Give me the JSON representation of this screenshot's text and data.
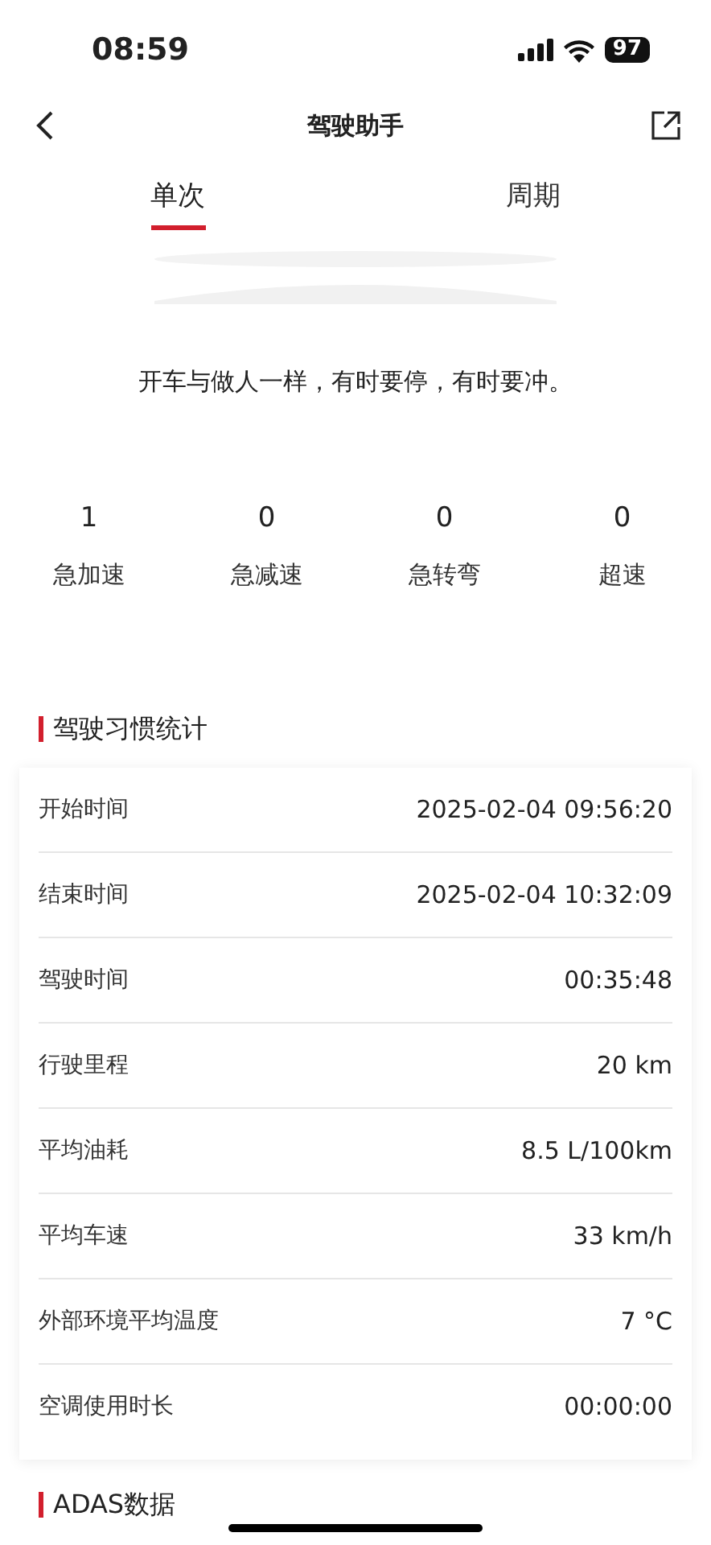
{
  "status_bar": {
    "time": "08:59",
    "battery": "97"
  },
  "nav": {
    "title": "驾驶助手"
  },
  "tabs": [
    {
      "label": "单次",
      "selected": true
    },
    {
      "label": "周期",
      "selected": false
    }
  ],
  "quote": "开车与做人一样，有时要停，有时要冲。",
  "events": [
    {
      "count": "1",
      "label": "急加速"
    },
    {
      "count": "0",
      "label": "急减速"
    },
    {
      "count": "0",
      "label": "急转弯"
    },
    {
      "count": "0",
      "label": "超速"
    }
  ],
  "habits": {
    "title": "驾驶习惯统计",
    "rows": [
      {
        "label": "开始时间",
        "value": "2025-02-04 09:56:20"
      },
      {
        "label": "结束时间",
        "value": "2025-02-04 10:32:09"
      },
      {
        "label": "驾驶时间",
        "value": "00:35:48"
      },
      {
        "label": "行驶里程",
        "value": "20 km"
      },
      {
        "label": "平均油耗",
        "value": "8.5 L/100km"
      },
      {
        "label": "平均车速",
        "value": "33 km/h"
      },
      {
        "label": "外部环境平均温度",
        "value": "7 °C"
      },
      {
        "label": "空调使用时长",
        "value": "00:00:00"
      }
    ]
  },
  "adas": {
    "title": "ADAS数据"
  }
}
